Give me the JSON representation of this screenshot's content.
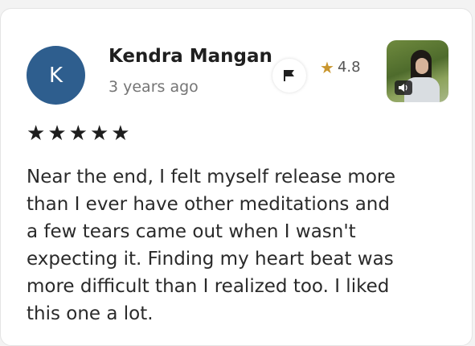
{
  "reviewer": {
    "initial": "K",
    "name": "Kendra Mangan",
    "time_ago": "3 years ago",
    "avatar_color": "#2e5e8e"
  },
  "content": {
    "rating_value": "4.8",
    "rating_star_color": "#c9962e",
    "thumbnail_icon": "audio-track-icon"
  },
  "review": {
    "stars": 5,
    "text": "Near the end, I felt myself release more than I ever have other meditations and a few tears came out when I wasn't expecting it. Finding my heart beat was more difficult than I realized too. I liked this one a lot."
  },
  "icons": {
    "flag": "flag-icon",
    "star": "star-icon"
  }
}
